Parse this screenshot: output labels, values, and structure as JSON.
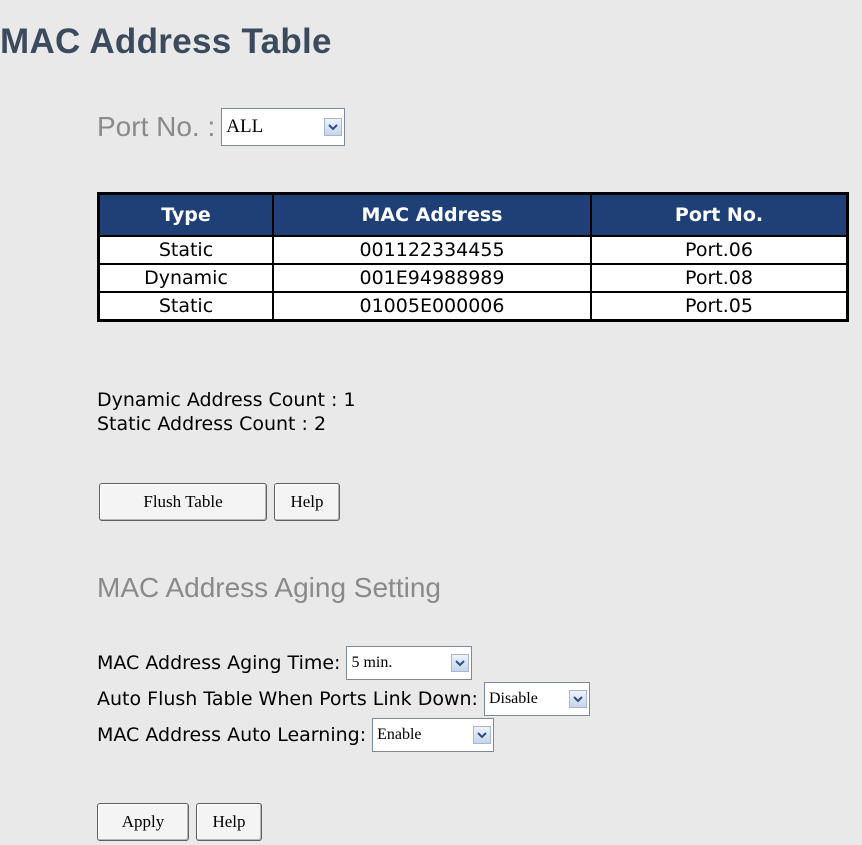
{
  "page": {
    "title": "MAC Address Table"
  },
  "port_filter": {
    "label": "Port No. :",
    "selected": "ALL"
  },
  "table": {
    "headers": [
      "Type",
      "MAC Address",
      "Port No."
    ],
    "rows": [
      [
        "Static",
        "001122334455",
        "Port.06"
      ],
      [
        "Dynamic",
        "001E94988989",
        "Port.08"
      ],
      [
        "Static",
        "01005E000006",
        "Port.05"
      ]
    ]
  },
  "counts": {
    "dynamic": "Dynamic Address Count : 1",
    "static": "Static Address Count : 2"
  },
  "table_buttons": {
    "flush": "Flush Table",
    "help": "Help"
  },
  "aging": {
    "title": "MAC Address Aging Setting",
    "aging_time_label": "MAC Address Aging Time:",
    "aging_time_value": "5 min.",
    "auto_flush_label": "Auto Flush Table When Ports Link Down:",
    "auto_flush_value": "Disable",
    "auto_learning_label": "MAC Address Auto Learning:",
    "auto_learning_value": "Enable"
  },
  "form_buttons": {
    "apply": "Apply",
    "help": "Help"
  },
  "colors": {
    "header_bg": "#1f3f77",
    "page_bg": "#e9e9e9",
    "title_color": "#3c4a5e"
  }
}
